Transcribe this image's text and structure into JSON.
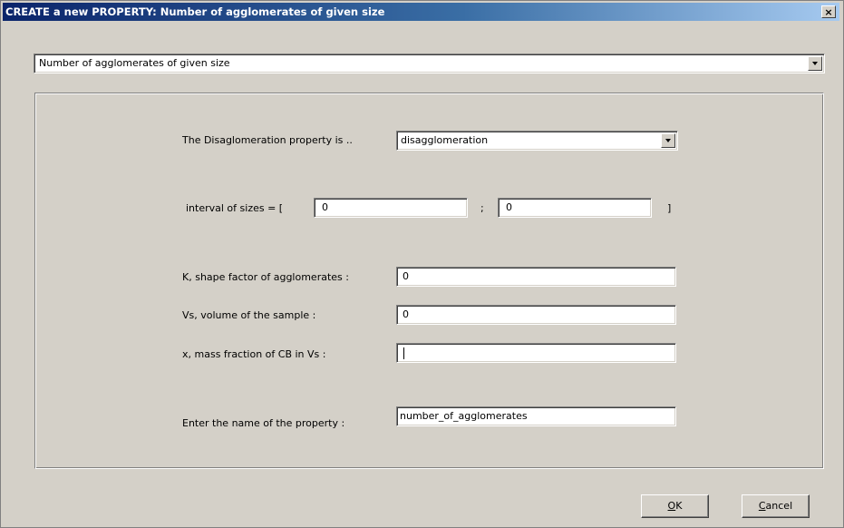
{
  "window": {
    "title": "CREATE a new PROPERTY: Number of agglomerates of given size",
    "close_glyph": "×"
  },
  "property_type": {
    "selected": "Number of agglomerates of given size"
  },
  "form": {
    "disagglomeration_label": "The Disaglomeration property is ..",
    "disagglomeration_selected": "disagglomeration",
    "interval_label": "interval of sizes = [",
    "interval_min": "0",
    "interval_separator": ";",
    "interval_max": "0",
    "interval_close": "]",
    "shape_factor_label": "K, shape factor of agglomerates :",
    "shape_factor_value": "0",
    "volume_label": "Vs, volume of the sample :",
    "volume_value": "0",
    "mass_fraction_label": "x, mass fraction of CB in Vs :",
    "mass_fraction_value": "",
    "name_label": "Enter the name of the property :",
    "name_value": "number_of_agglomerates"
  },
  "buttons": {
    "ok_mnemonic": "O",
    "ok_rest": "K",
    "cancel_mnemonic": "C",
    "cancel_rest": "ancel"
  }
}
